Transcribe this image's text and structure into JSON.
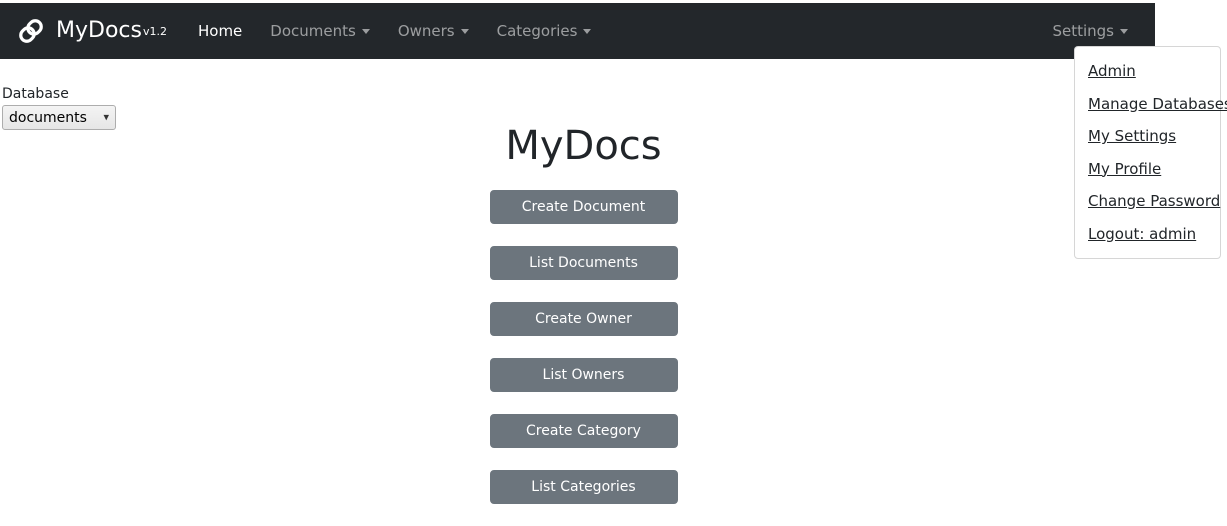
{
  "navbar": {
    "brand": {
      "icon": "chain-link-icon",
      "name": "MyDocs",
      "version": "v1.2"
    },
    "links": [
      {
        "label": "Home",
        "active": true,
        "has_caret": false
      },
      {
        "label": "Documents",
        "active": false,
        "has_caret": true
      },
      {
        "label": "Owners",
        "active": false,
        "has_caret": true
      },
      {
        "label": "Categories",
        "active": false,
        "has_caret": true
      }
    ],
    "settings": {
      "label": "Settings",
      "has_caret": true
    },
    "background_color": "#23272b"
  },
  "settings_menu": {
    "open": true,
    "items": [
      {
        "label": "Admin"
      },
      {
        "label": "Manage Databases"
      },
      {
        "label": "My Settings"
      },
      {
        "label": "My Profile"
      },
      {
        "label": "Change Password"
      },
      {
        "label": "Logout: admin"
      }
    ]
  },
  "database_selector": {
    "label": "Database",
    "selected": "documents",
    "options": [
      "documents"
    ],
    "chevron_icon": "chevron-down-icon"
  },
  "main": {
    "title": "MyDocs",
    "buttons": [
      {
        "label": "Create Document"
      },
      {
        "label": "List Documents"
      },
      {
        "label": "Create Owner"
      },
      {
        "label": "List Owners"
      },
      {
        "label": "Create Category"
      },
      {
        "label": "List Categories"
      }
    ],
    "button_color": "#6c757d"
  }
}
